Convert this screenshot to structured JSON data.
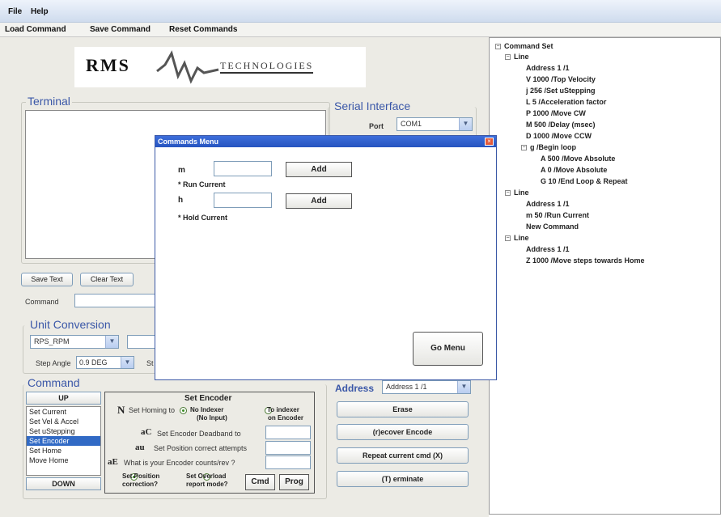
{
  "menubar": {
    "file": "File",
    "help": "Help"
  },
  "toolbar": {
    "load": "Load Command",
    "save": "Save Command",
    "reset": "Reset Commands"
  },
  "logo": {
    "text_left": "RMS",
    "text_right": "TECHNOLOGIES"
  },
  "terminal": {
    "label": "Terminal",
    "save_text": "Save Text",
    "clear_text": "Clear Text",
    "command_label": "Command"
  },
  "serial": {
    "label": "Serial Interface",
    "port_label": "Port",
    "port_value": "COM1"
  },
  "unit_conversion": {
    "label": "Unit Conversion",
    "units_value": "RPS_RPM",
    "step_angle_label": "Step Angle",
    "step_angle_value": "0.9 DEG",
    "truncated_label": "St"
  },
  "command": {
    "label": "Command",
    "up": "UP",
    "down": "DOWN",
    "items": [
      "Set Current",
      "Set Vel & Accel",
      "Set uStepping",
      "Set Encoder",
      "Set Home",
      "Move Home"
    ],
    "selected_index": 3
  },
  "encoder": {
    "title": "Set Encoder",
    "n_letter": "N",
    "homing_label": "Set Homing to",
    "no_indexer": "No Indexer",
    "no_input": "(No Input)",
    "to_indexer": "To indexer",
    "on_encoder": "on Encoder",
    "ac_letter": "aC",
    "ac_label": "Set Encoder Deadband to",
    "au_letter": "au",
    "au_label": "Set Position correct attempts",
    "ae_letter": "aE",
    "ae_label": "What is your Encoder counts/rev ?",
    "set_position": "Set Position",
    "correction": "correction?",
    "set_overload": "Set Overload",
    "report_mode": "report mode?",
    "cmd": "Cmd",
    "prog": "Prog"
  },
  "address": {
    "label": "Address",
    "value": "Address 1 /1"
  },
  "right_buttons": {
    "erase": "Erase",
    "recover": "(r)ecover Encode",
    "repeat": "Repeat current cmd (X)",
    "terminate": "(T) erminate"
  },
  "dialog": {
    "title": "Commands Menu",
    "close": "×",
    "m_label": "m",
    "m_hint": "* Run Current",
    "h_label": "h",
    "h_hint": "* Hold Current",
    "add": "Add",
    "go_menu": "Go Menu"
  },
  "tree": {
    "root": "Command Set",
    "line1": "Line",
    "l1_items": [
      "Address 1 /1",
      "V 1000 /Top Velocity",
      "j 256 /Set uStepping",
      "L 5 /Acceleration factor",
      "P 1000 /Move CW",
      "M 500 /Delay (msec)",
      "D 1000 /Move CCW"
    ],
    "loop": "g /Begin loop",
    "loop_items": [
      "A 500 /Move Absolute",
      "A 0 /Move Absolute",
      "G 10 /End Loop & Repeat"
    ],
    "line2": "Line",
    "l2_items": [
      "Address 1 /1",
      "m 50 /Run Current",
      "New Command"
    ],
    "line3": "Line",
    "l3_items": [
      "Address 1 /1",
      "Z 1000 /Move steps towards Home"
    ]
  }
}
